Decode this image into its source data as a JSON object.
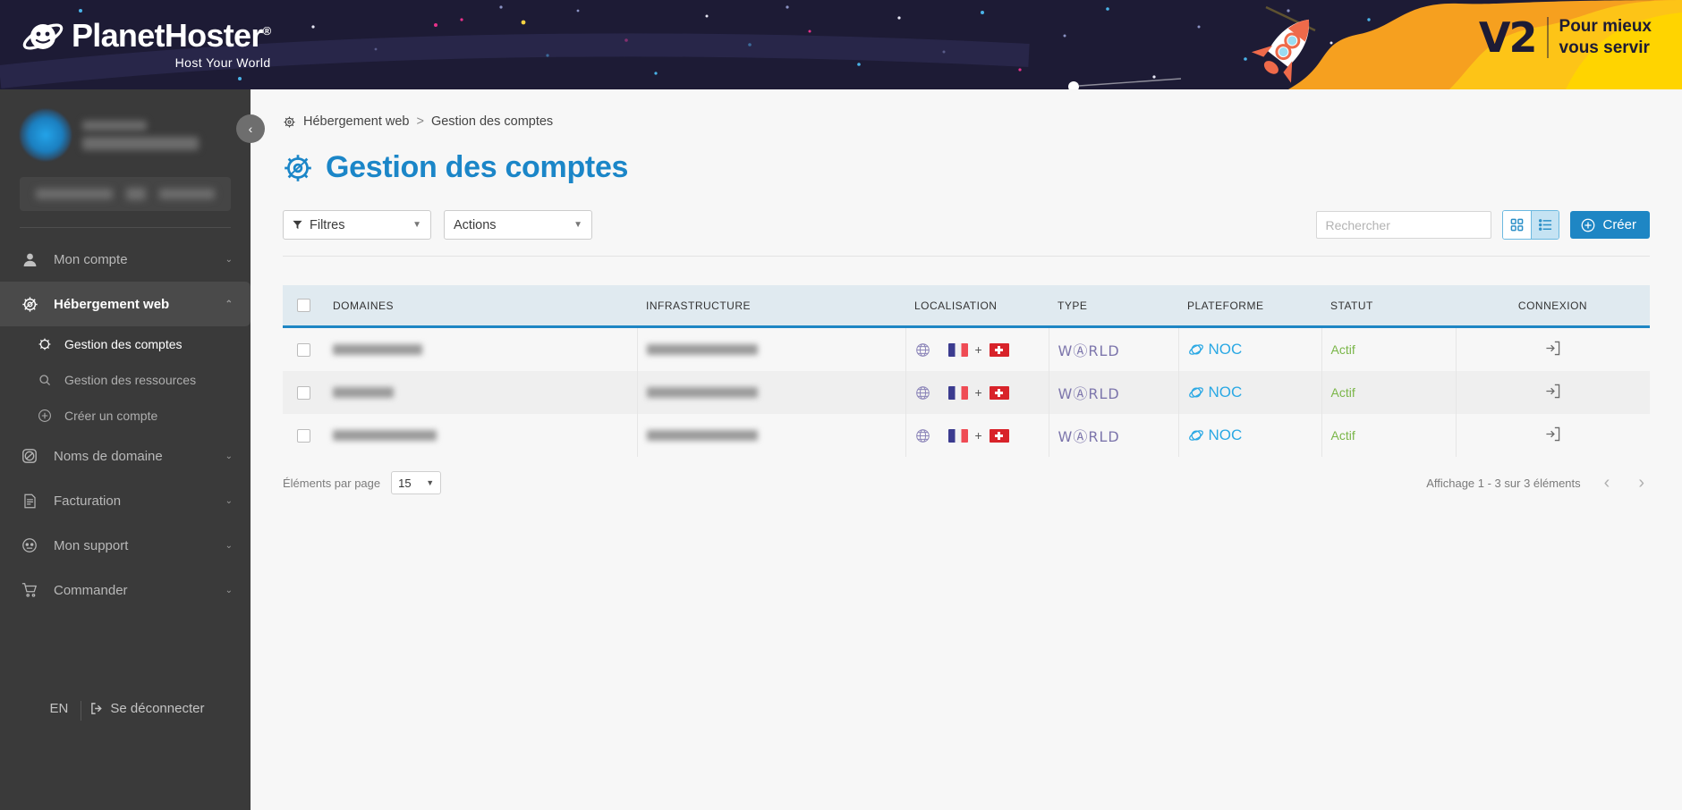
{
  "banner": {
    "logo_name": "PlanetHoster",
    "logo_registered": "®",
    "tagline": "Host Your World",
    "v2_mark": "V2",
    "v2_line1": "Pour mieux",
    "v2_line2": "vous servir"
  },
  "sidebar": {
    "collapse_icon": "‹",
    "nav": [
      {
        "label": "Mon compte",
        "icon": "user-icon",
        "chevron": "⌄",
        "active": false
      },
      {
        "label": "Hébergement web",
        "icon": "gear-planet-icon",
        "chevron": "⌃",
        "active": true
      },
      {
        "label": "Noms de domaine",
        "icon": "globe-icon",
        "chevron": "⌄",
        "active": false
      },
      {
        "label": "Facturation",
        "icon": "invoice-icon",
        "chevron": "⌄",
        "active": false
      },
      {
        "label": "Mon support",
        "icon": "headset-icon",
        "chevron": "⌄",
        "active": false
      },
      {
        "label": "Commander",
        "icon": "cart-icon",
        "chevron": "⌄",
        "active": false
      }
    ],
    "subitems": [
      {
        "label": "Gestion des comptes",
        "icon": "gear-planet-icon",
        "current": true
      },
      {
        "label": "Gestion des ressources",
        "icon": "resource-gear-icon",
        "current": false
      },
      {
        "label": "Créer un compte",
        "icon": "plus-circle-icon",
        "current": false
      }
    ],
    "language": "EN",
    "logout": "Se déconnecter"
  },
  "breadcrumb": {
    "root": "Hébergement web",
    "separator": ">",
    "current": "Gestion des comptes"
  },
  "page": {
    "title": "Gestion des comptes"
  },
  "toolbar": {
    "filters_label": "Filtres",
    "actions_label": "Actions",
    "search_placeholder": "Rechercher",
    "search_value": "",
    "create_label": "Créer",
    "grid_view": "grid-view-icon",
    "list_view": "list-view-icon",
    "active_view": "list"
  },
  "table": {
    "columns": [
      "DOMAINES",
      "INFRASTRUCTURE",
      "LOCALISATION",
      "TYPE",
      "PLATEFORME",
      "STATUT",
      "CONNEXION"
    ],
    "rows": [
      {
        "domain": "",
        "domain_width": 100,
        "infrastructure": "",
        "infra_width": 124,
        "localisation": [
          "FR",
          "CH"
        ],
        "loc_join": "+",
        "type": "WⒶRLD",
        "plateforme": "NOC",
        "statut": "Actif",
        "connexion": "login-arrow-icon"
      },
      {
        "domain": "",
        "domain_width": 68,
        "infrastructure": "",
        "infra_width": 124,
        "localisation": [
          "FR",
          "CH"
        ],
        "loc_join": "+",
        "type": "WⒶRLD",
        "plateforme": "NOC",
        "statut": "Actif",
        "connexion": "login-arrow-icon"
      },
      {
        "domain": "",
        "domain_width": 116,
        "infrastructure": "",
        "infra_width": 124,
        "localisation": [
          "FR",
          "CH"
        ],
        "loc_join": "+",
        "type": "WⒶRLD",
        "plateforme": "NOC",
        "statut": "Actif",
        "connexion": "login-arrow-icon"
      }
    ]
  },
  "footer": {
    "per_page_label": "Éléments par page",
    "per_page_value": "15",
    "display_info": "Affichage 1 - 3 sur 3 éléments",
    "prev": "‹",
    "next": "›"
  },
  "colors": {
    "brand_blue": "#1e86c4",
    "banner_dark": "#1d1b35",
    "banner_orange": "#f5a623",
    "status_green": "#7ab648",
    "world_purple": "#7d76ac",
    "noc_cyan": "#2aa8e4"
  }
}
